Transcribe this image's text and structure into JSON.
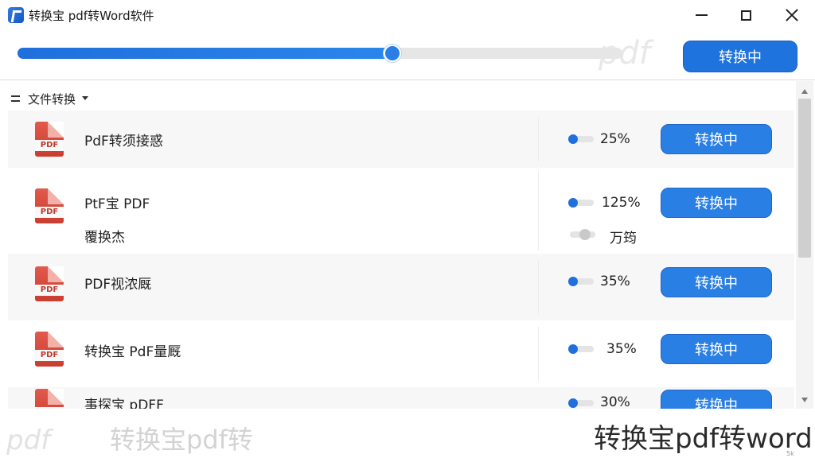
{
  "window": {
    "title": "转换宝 pdf转Word软件",
    "controls": {
      "minimize": "minimize",
      "maximize": "maximize",
      "close": "close"
    }
  },
  "top_bar": {
    "progress": 0.62,
    "button_label": "转换中",
    "watermark": "pdf"
  },
  "list_header": {
    "label": "文件转换"
  },
  "files": [
    {
      "name": "PdF转须接惑",
      "percent": "25%",
      "progress": 0.25,
      "button": "转换中"
    },
    {
      "name": "PtF宝 PDF",
      "sub": "覆换杰",
      "percent": "125%",
      "progress": 0.25,
      "sub_value": "万筠",
      "button": "转换中"
    },
    {
      "name": "PDF视浓厩",
      "percent": "35%",
      "progress": 0.25,
      "button": "转换中"
    },
    {
      "name": "转换宝 PdF量厩",
      "percent": "35%",
      "progress": 0.25,
      "button": "转换中"
    },
    {
      "name": "事探宝 pDFF",
      "percent": "30%",
      "progress": 0.25,
      "button": "转换中"
    }
  ],
  "pdf_tag": "PDF",
  "bottom": {
    "watermark_left": "转换宝pdf转",
    "watermark_pdf": "pdf",
    "watermark_right": "转换宝pdf转word",
    "corner": "5k"
  },
  "colors": {
    "accent": "#1f73dc",
    "pdf_red": "#d24a3c"
  }
}
